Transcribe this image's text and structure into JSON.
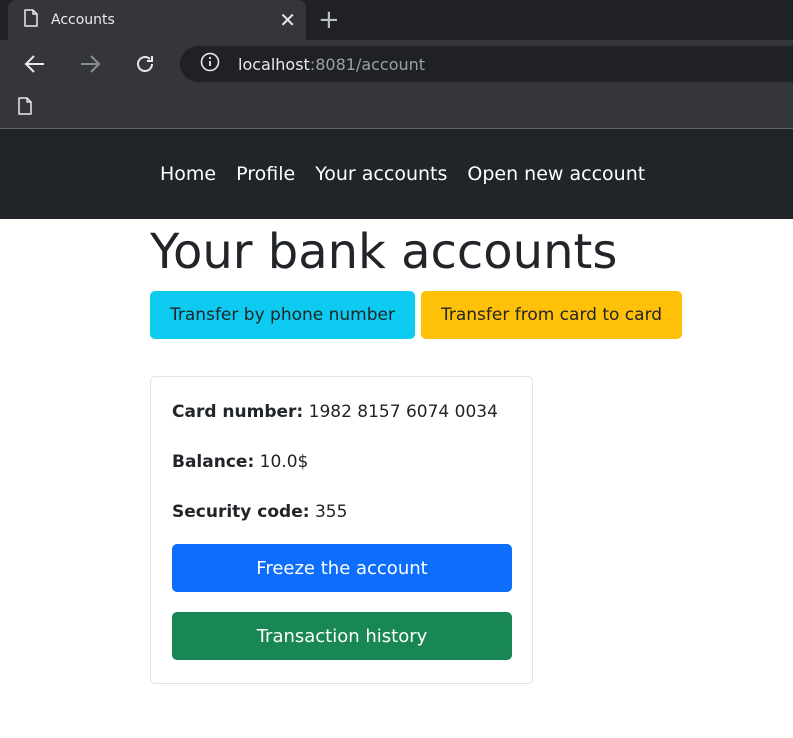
{
  "browser": {
    "tab_title": "Accounts",
    "close_glyph": "✕",
    "new_tab_glyph": "+",
    "url_host": "localhost",
    "url_rest": ":8081/account",
    "icons": [
      "page-icon",
      "close-icon",
      "plus-icon",
      "back-icon",
      "forward-icon",
      "reload-icon",
      "info-icon",
      "bookmark-page-icon"
    ]
  },
  "nav": {
    "items": [
      {
        "label": "Home"
      },
      {
        "label": "Profile"
      },
      {
        "label": "Your accounts"
      },
      {
        "label": "Open new account"
      }
    ]
  },
  "page": {
    "title": "Your bank accounts",
    "transfer_phone_label": "Transfer by phone number",
    "transfer_card_label": "Transfer from card to card"
  },
  "account": {
    "card_number_label": "Card number:",
    "card_number": "1982 8157 6074 0034",
    "balance_label": "Balance:",
    "balance": "10.0$",
    "security_code_label": "Security code:",
    "security_code": "355",
    "freeze_label": "Freeze the account",
    "history_label": "Transaction history"
  },
  "colors": {
    "navbar": "#212529",
    "info": "#0dcaf0",
    "warning": "#ffc107",
    "primary": "#0d6efd",
    "success": "#198754"
  }
}
